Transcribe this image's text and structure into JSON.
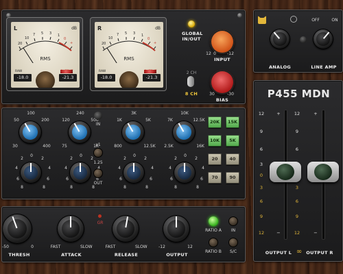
{
  "meters": {
    "left": {
      "channel": "L",
      "unit": "dB",
      "mode": "RMS",
      "raw_caption": "RAW",
      "out_caption": "OUTPUT",
      "raw_value": "-18.0",
      "out_value": "-21.3"
    },
    "right": {
      "channel": "R",
      "unit": "dB",
      "mode": "RMS",
      "raw_caption": "RAW",
      "out_caption": "OUTPUT",
      "raw_value": "-18.0",
      "out_value": "-21.3"
    },
    "scale": [
      "-20",
      "10",
      "7",
      "5",
      "3",
      "1",
      "0",
      "1",
      "2",
      "3"
    ]
  },
  "global": {
    "label_line1": "GLOBAL",
    "label_line2": "IN/OUT",
    "mode_top": "2 CH",
    "mode_bottom": "8 CH"
  },
  "input_knob": {
    "label": "INPUT",
    "min": "0",
    "max": "-12",
    "left_mark": "12"
  },
  "bias_knob": {
    "label": "BIAS",
    "min": "30",
    "max": "-30"
  },
  "toggles": {
    "off_label": "OFF",
    "on_label": "ON",
    "analog_label": "ANALOG",
    "line_amp_label": "LINE AMP"
  },
  "brand": {
    "title": "P455 MDN"
  },
  "faders": {
    "scale": [
      "12",
      "+",
      "9",
      "6",
      "3",
      "0",
      "3",
      "6",
      "9",
      "12",
      "−"
    ],
    "left_label": "OUTPUT L",
    "right_label": "OUTPUT R",
    "link_symbol": "∞"
  },
  "eq": {
    "freq_labels": [
      {
        "top": "100",
        "left": "50",
        "right": "200",
        "bl": "30",
        "br": "400"
      },
      {
        "top": "240",
        "left": "120",
        "right": "500",
        "bl": "75",
        "br": "1K"
      },
      {
        "top": "3K",
        "left": "1K",
        "right": "5K",
        "bl": "800",
        "br": "12.5K"
      },
      {
        "top": "10K",
        "left": "7K",
        "right": "12.5K",
        "bl": "2.5K",
        "br": "16K"
      }
    ],
    "in_label": "IN",
    "out_label": "OUT",
    "q_labels": [
      "x1",
      "1.25"
    ],
    "gain_scale": [
      "0",
      "2",
      "4",
      "6",
      "8",
      "9",
      "12"
    ],
    "buttons": [
      {
        "label": "20K",
        "state": "green"
      },
      {
        "label": "15K",
        "state": "green"
      },
      {
        "label": "10K",
        "state": "green"
      },
      {
        "label": "5K",
        "state": "green"
      },
      {
        "label": "20",
        "state": "gray"
      },
      {
        "label": "40",
        "state": "gray"
      },
      {
        "label": "70",
        "state": "gray"
      },
      {
        "label": "90",
        "state": "gray"
      }
    ]
  },
  "comp": {
    "thresh": {
      "label": "THRESH",
      "min": "-50",
      "max": "0"
    },
    "attack": {
      "label": "ATTACK",
      "min": "FAST",
      "max": "SLOW"
    },
    "gr_label": "GR",
    "release": {
      "label": "RELEASE",
      "min": "FAST",
      "max": "SLOW"
    },
    "output": {
      "label": "OUTPUT",
      "min": "-12",
      "max": "12"
    },
    "ratio_a": "RATIO A",
    "ratio_b": "RATIO B",
    "in_label": "IN",
    "sc_label": "S/C"
  },
  "colors": {
    "accent_blue": "#4aa6ea",
    "led_green": "#4cf02a",
    "led_yellow": "#f5c400"
  }
}
